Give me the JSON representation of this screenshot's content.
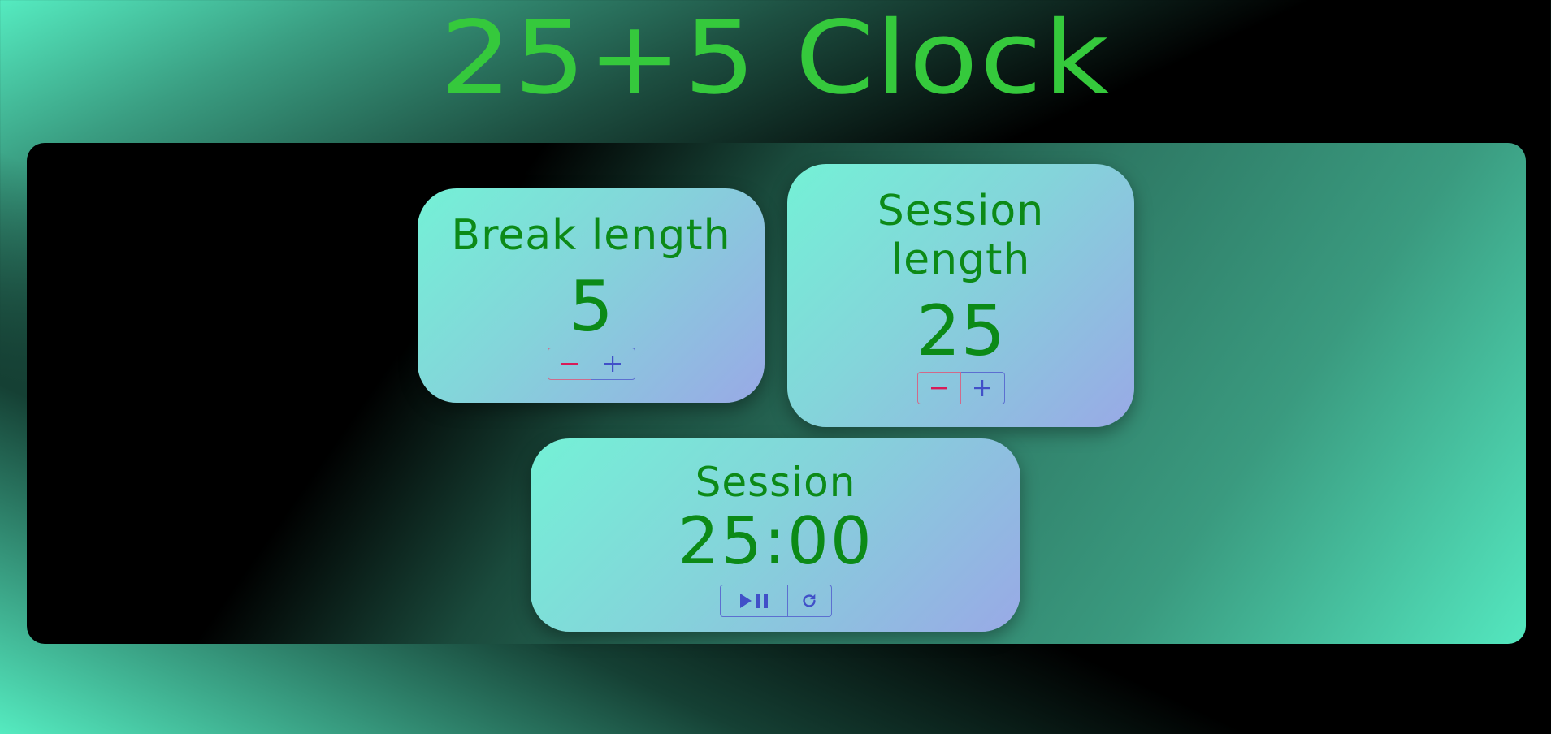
{
  "app": {
    "title": "25+5 Clock"
  },
  "break_card": {
    "label": "Break length",
    "value": "5",
    "decrement_icon": "minus-icon",
    "increment_icon": "plus-icon"
  },
  "session_card": {
    "label": "Session length",
    "value": "25",
    "decrement_icon": "minus-icon",
    "increment_icon": "plus-icon"
  },
  "timer_card": {
    "label": "Session",
    "time": "25:00",
    "play_icon": "play-icon",
    "pause_icon": "pause-icon",
    "reset_icon": "reset-icon"
  },
  "colors": {
    "title": "#35c93c",
    "card_text": "#0c8a17",
    "minus_icon": "#d81b58",
    "button_icon": "#4150c8"
  }
}
